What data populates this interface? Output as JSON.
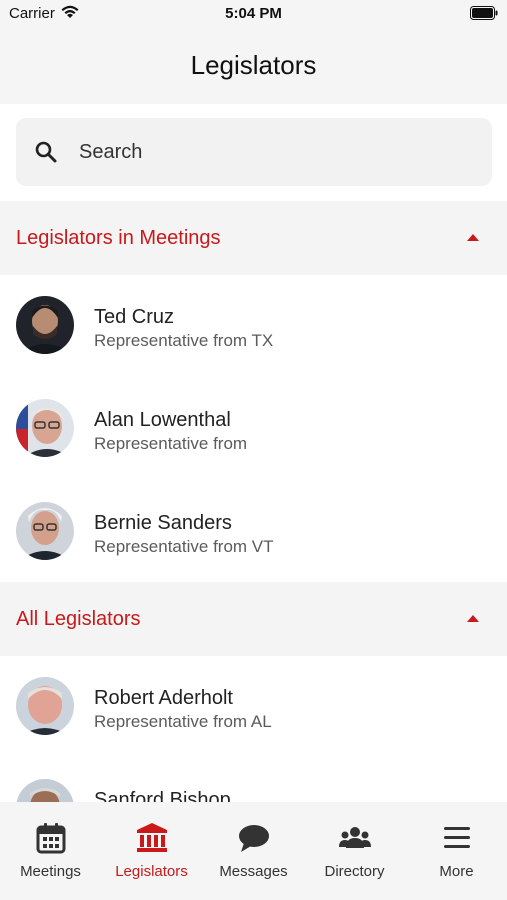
{
  "status_bar": {
    "carrier": "Carrier",
    "time": "5:04 PM"
  },
  "nav": {
    "title": "Legislators"
  },
  "search": {
    "placeholder": "Search"
  },
  "sections": [
    {
      "title": "Legislators in Meetings",
      "items": [
        {
          "name": "Ted Cruz",
          "subtitle": "Representative from TX"
        },
        {
          "name": "Alan Lowenthal",
          "subtitle": "Representative from"
        },
        {
          "name": "Bernie Sanders",
          "subtitle": "Representative from VT"
        }
      ]
    },
    {
      "title": "All Legislators",
      "items": [
        {
          "name": "Robert Aderholt",
          "subtitle": "Representative from AL"
        },
        {
          "name": "Sanford Bishop",
          "subtitle": ""
        }
      ]
    }
  ],
  "tabs": [
    {
      "label": "Meetings",
      "icon": "calendar-icon"
    },
    {
      "label": "Legislators",
      "icon": "capitol-icon",
      "active": true
    },
    {
      "label": "Messages",
      "icon": "chat-bubble-icon"
    },
    {
      "label": "Directory",
      "icon": "people-icon"
    },
    {
      "label": "More",
      "icon": "menu-icon"
    }
  ],
  "colors": {
    "accent": "#c8191b",
    "section_bg": "#f4f4f4",
    "tab_inactive": "#333333"
  }
}
